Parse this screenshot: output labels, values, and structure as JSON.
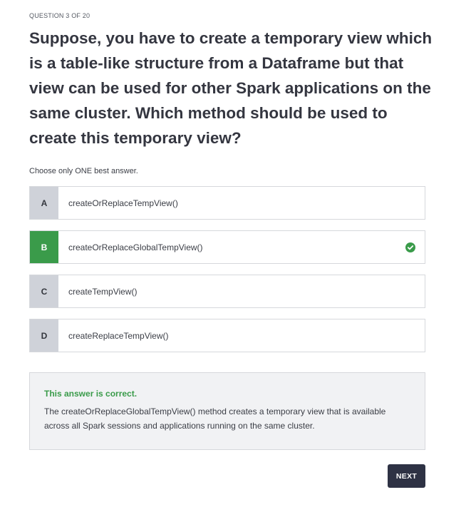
{
  "question": {
    "counter": "QUESTION 3 OF 20",
    "text": "Suppose, you have to create a temporary view which is a table-like structure from a Dataframe but that view can be used for other Spark applications on the same cluster. Which method should be used to create this temporary view?",
    "hint": "Choose only ONE best answer."
  },
  "options": [
    {
      "letter": "A",
      "text": "createOrReplaceTempView()"
    },
    {
      "letter": "B",
      "text": "createOrReplaceGlobalTempView()",
      "correct": true,
      "icon": "check-circle-icon"
    },
    {
      "letter": "C",
      "text": "createTempView()"
    },
    {
      "letter": "D",
      "text": "createReplaceTempView()"
    }
  ],
  "feedback": {
    "title": "This answer is correct.",
    "text": "The createOrReplaceGlobalTempView() method creates a temporary view that is available across all Spark sessions and applications running on the same cluster."
  },
  "next_label": "NEXT",
  "colors": {
    "correct": "#3a9b4a",
    "button": "#2e3244",
    "letter_bg": "#cfd2d9"
  }
}
